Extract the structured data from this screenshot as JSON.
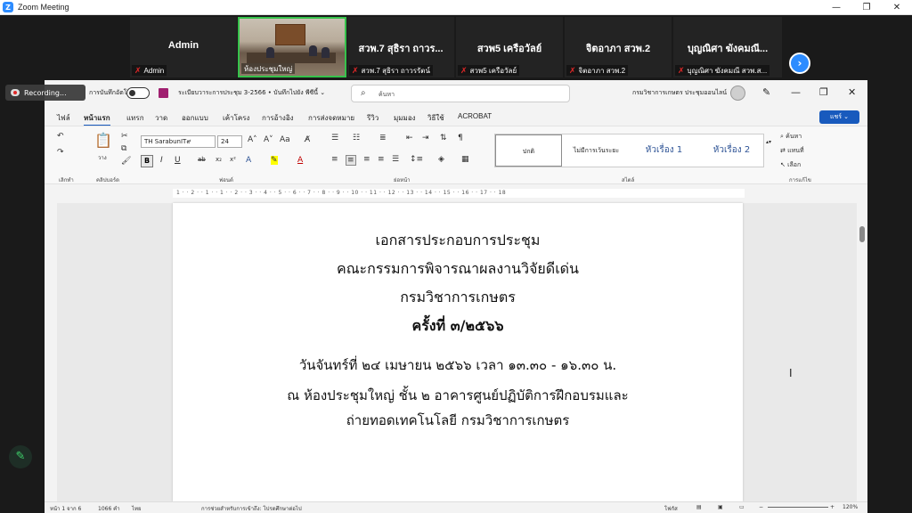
{
  "window": {
    "title": "Zoom Meeting",
    "logo": "Z",
    "controls": [
      "—",
      "❐",
      "✕"
    ]
  },
  "participants": [
    {
      "name": "Admin",
      "label": "Admin"
    },
    {
      "name": "",
      "label": "ห้องประชุมใหญ่"
    },
    {
      "name": "สวพ.7 สุธิรา ถาวร...",
      "label": "สวพ.7 สุธิรา ถาวรรัตน์"
    },
    {
      "name": "สวพ5 เครือวัลย์",
      "label": "สวพ5 เครือวัลย์"
    },
    {
      "name": "จิตอาภา สวพ.2",
      "label": "จิตอาภา สวพ.2"
    },
    {
      "name": "บุญณิศา ฆังคมณี...",
      "label": "บุญณิศา ฆังคมณี สวพ.ส..."
    }
  ],
  "next_button": "›",
  "recording": {
    "label": "Recording..."
  },
  "word": {
    "autosave_label": "การบันทึกอัตโนมัติ",
    "doc_title": "ระเบียบวาระการประชุม 3-2566 • บันทึกไปยัง พีซีนี้ ⌄",
    "search_placeholder": "ค้นหา",
    "org_name": "กรมวิชาการเกษตร ประชุมออนไลน์",
    "controls": [
      "—",
      "❐",
      "✕"
    ],
    "tabs": [
      "ไฟล์",
      "หน้าแรก",
      "แทรก",
      "วาด",
      "ออกแบบ",
      "เค้าโครง",
      "การอ้างอิง",
      "การส่งจดหมาย",
      "รีวิว",
      "มุมมอง",
      "วิธีใช้",
      "ACROBAT"
    ],
    "share_label": "แชร์ ⌄",
    "ribbon": {
      "font_name": "TH SarabunIT๙",
      "font_size": "24",
      "groups": [
        "เลิกทำ",
        "คลิปบอร์ด",
        "ฟอนต์",
        "ย่อหน้า",
        "สไตล์",
        "การแก้ไข"
      ],
      "paste_label": "วาง",
      "styles": [
        "ปกติ",
        "ไม่มีการเว้นระยะ",
        "หัวเรื่อง 1",
        "หัวเรื่อง 2"
      ],
      "find_label": "ค้นหา",
      "replace_label": "แทนที่",
      "select_label": "เลือก"
    },
    "ruler_numbers": "1 · · 2 · · 1 · · 1 · · 2 · · 3 · · 4 · · 5 · · 6 · · 7 · · 8 · · 9 · · 10 · · 11 · · 12 · · 13 · · 14 · · 15 · · 16 · · 17 · · 18",
    "document_lines": [
      "เอกสารประกอบการประชุม",
      "คณะกรรมการพิจารณาผลงานวิจัยดีเด่น",
      "กรมวิชาการเกษตร",
      "ครั้งที่ ๓/๒๕๖๖",
      "วันจันทร์ที่ ๒๔ เมษายน ๒๕๖๖ เวลา ๑๓.๓๐ - ๑๖.๓๐ น.",
      "ณ ห้องประชุมใหญ่ ชั้น ๒ อาคารศูนย์ปฏิบัติการฝึกอบรมและ",
      "ถ่ายทอดเทคโนโลยี กรมวิชาการเกษตร"
    ],
    "status": {
      "page": "หน้า 1 จาก 6",
      "words": "1066 คำ",
      "lang": "ไทย",
      "accessibility": "การช่วยสำหรับการเข้าถึง: โปรดศึกษาต่อไป",
      "focus": "โฟกัส",
      "zoom": "120%"
    }
  }
}
